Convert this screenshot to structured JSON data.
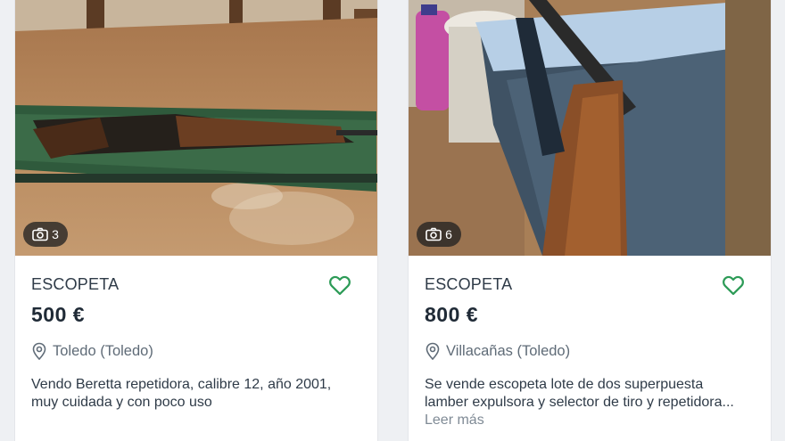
{
  "listings": [
    {
      "photo_count": "3",
      "title": "ESCOPETA",
      "price": "500 €",
      "location": "Toledo (Toledo)",
      "description_lines": [
        "Vendo Beretta repetidora, calibre 12, año 2001,",
        "muy cuidada y con poco uso"
      ],
      "icons": {
        "camera": "camera-icon",
        "favorite": "heart-icon",
        "location": "map-pin-icon"
      }
    },
    {
      "photo_count": "6",
      "title": "ESCOPETA",
      "price": "800 €",
      "location": "Villacañas (Toledo)",
      "description_lines": [
        "Se vende escopeta lote de dos superpuesta",
        "lamber expulsora y selector de tiro y repetidora..."
      ],
      "read_more": "Leer más",
      "icons": {
        "camera": "camera-icon",
        "favorite": "heart-icon",
        "location": "map-pin-icon"
      }
    }
  ],
  "colors": {
    "accent_heart": "#2d9b57",
    "title_text": "#2f3b48",
    "price_text": "#1f2a36",
    "muted_text": "#5f6b77"
  }
}
